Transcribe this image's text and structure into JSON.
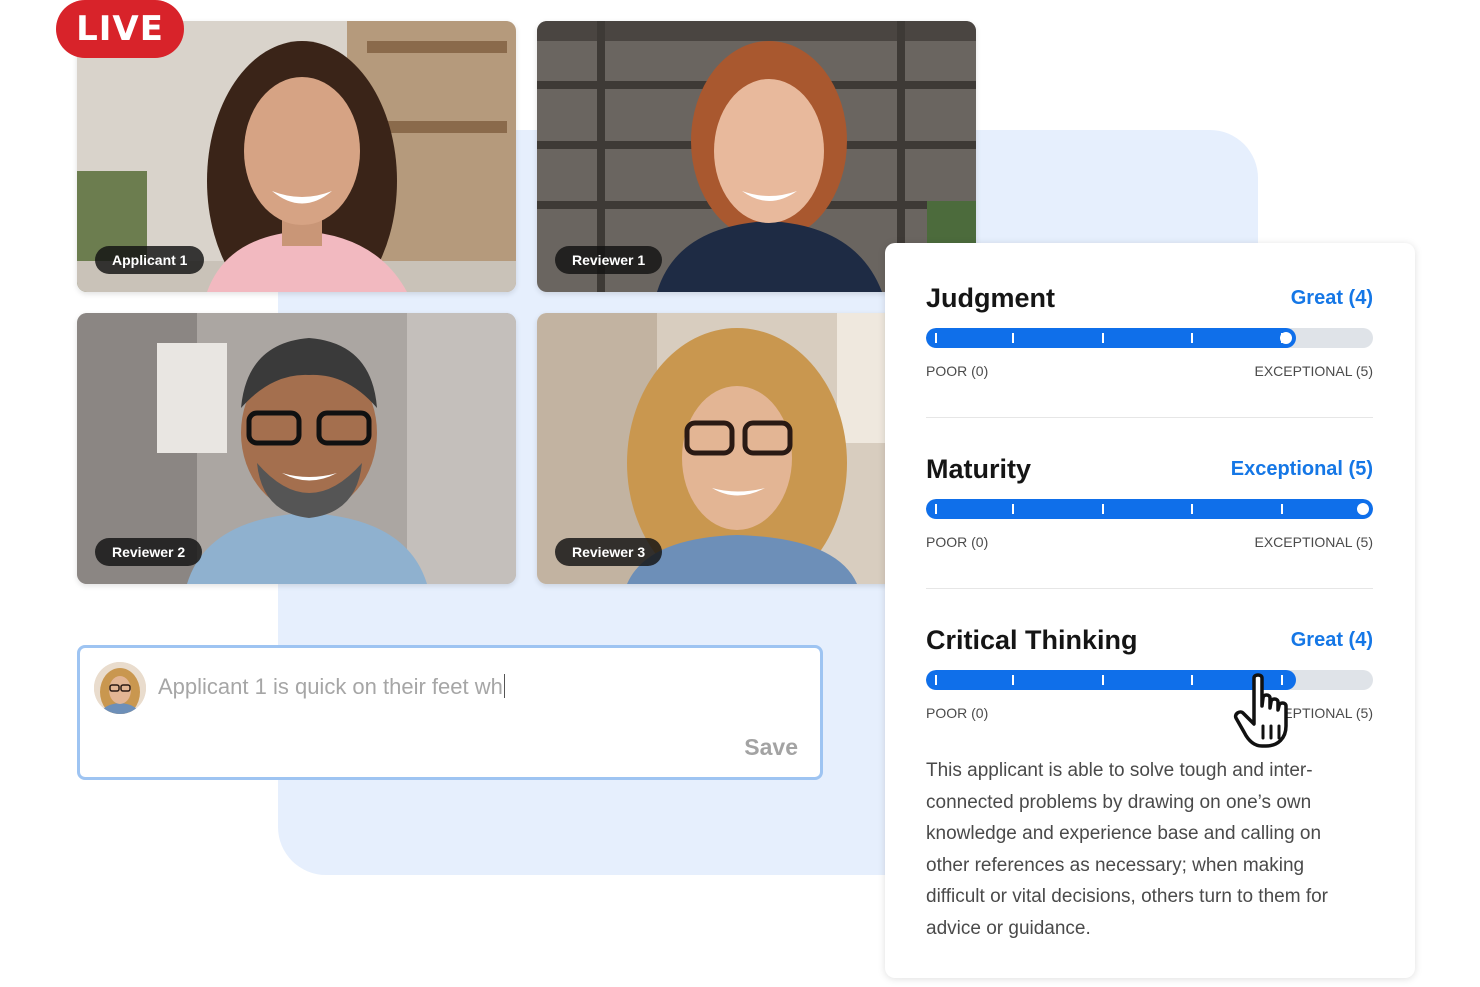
{
  "live_badge": "LIVE",
  "participants": [
    {
      "label": "Applicant 1"
    },
    {
      "label": "Reviewer 1"
    },
    {
      "label": "Reviewer 2"
    },
    {
      "label": "Reviewer 3"
    }
  ],
  "comment": {
    "value": "Applicant 1 is quick on their feet wh",
    "save_label": "Save"
  },
  "criteria": [
    {
      "title": "Judgment",
      "value_label": "Great (4)",
      "score": 4,
      "max": 5,
      "min_label": "POOR (0)",
      "max_label": "EXCEPTIONAL (5)"
    },
    {
      "title": "Maturity",
      "value_label": "Exceptional (5)",
      "score": 5,
      "max": 5,
      "min_label": "POOR (0)",
      "max_label": "EXCEPTIONAL (5)"
    },
    {
      "title": "Critical Thinking",
      "value_label": "Great (4)",
      "score": 4,
      "max": 5,
      "min_label": "POOR (0)",
      "max_label": "EXCEPTIONAL (5)"
    }
  ],
  "description": "This applicant is able to solve tough and inter- connected problems by drawing on one’s own knowledge and experience base and calling on other references as necessary; when making difficult or vital decisions, others turn to them for advice or guidance.",
  "colors": {
    "accent": "#0f6fea",
    "live": "#d8232a",
    "panel": "#e6effd",
    "input_border": "#9ec4f2"
  }
}
